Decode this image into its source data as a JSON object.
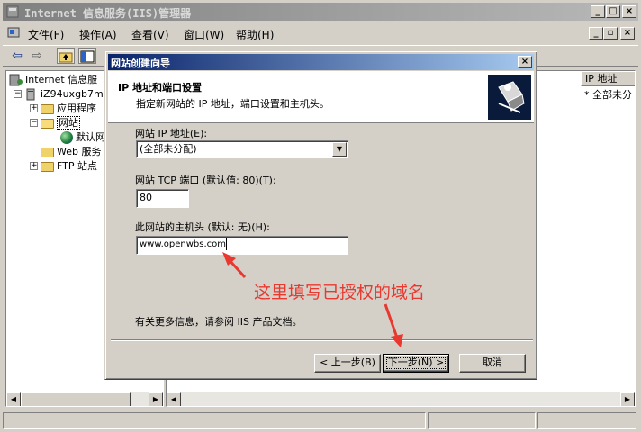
{
  "main_window": {
    "title": "Internet 信息服务(IIS)管理器",
    "controls": {
      "minimize": "_",
      "maximize": "□",
      "close": "×"
    }
  },
  "menubar": {
    "items": [
      "文件(F)",
      "操作(A)",
      "查看(V)",
      "窗口(W)",
      "帮助(H)"
    ],
    "mdi_controls": {
      "minimize": "_",
      "restore": "▫",
      "close": "×"
    }
  },
  "tree": {
    "root": "Internet 信息服",
    "server": "iZ94uxgb7mo",
    "items": [
      {
        "label": "应用程序",
        "icon": "folder"
      },
      {
        "label": "网站",
        "icon": "folder"
      },
      {
        "label": "默认网",
        "icon": "globe"
      },
      {
        "label": "Web 服务",
        "icon": "folder"
      },
      {
        "label": "FTP 站点",
        "icon": "folder"
      }
    ]
  },
  "list": {
    "column_ip": "IP 地址",
    "value_ip": "* 全部未分"
  },
  "wizard": {
    "title": "网站创建向导",
    "close": "×",
    "header_title": "IP 地址和端口设置",
    "header_subtitle": "指定新网站的 IP 地址，端口设置和主机头。",
    "ip_label": "网站 IP 地址(E):",
    "ip_value": "(全部未分配)",
    "port_label": "网站 TCP 端口 (默认值: 80)(T):",
    "port_value": "80",
    "host_label": "此网站的主机头 (默认: 无)(H):",
    "host_value": "www.openwbs.com",
    "more_info": "有关更多信息，请参阅 IIS 产品文档。",
    "btn_back": "< 上一步(B)",
    "btn_next": "下一步(N) >",
    "btn_cancel": "取消"
  },
  "annotation": {
    "text": "这里填写已授权的域名",
    "color": "#e8382f"
  }
}
